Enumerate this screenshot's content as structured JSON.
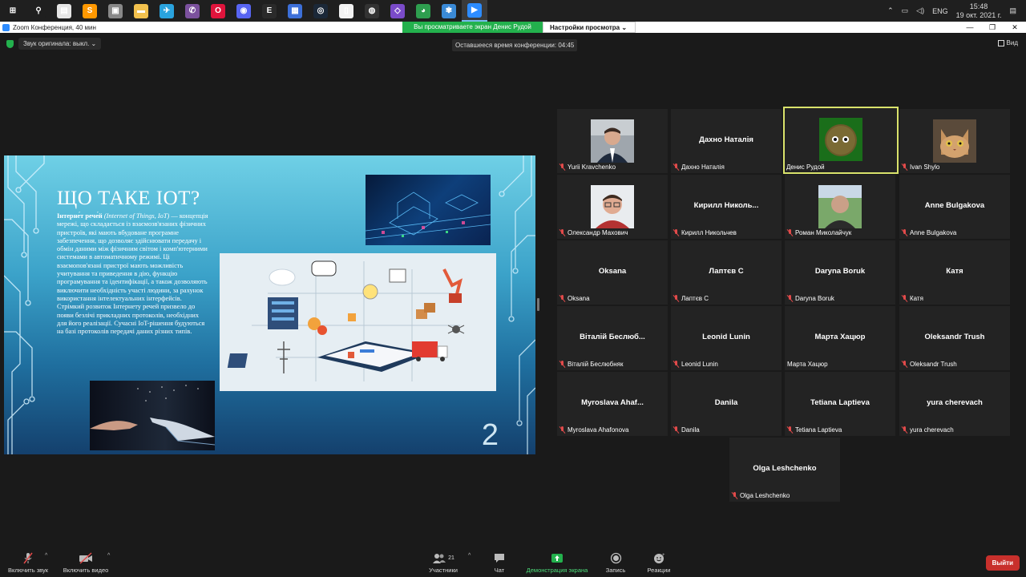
{
  "taskbar": {
    "apps": [
      {
        "name": "windows-start",
        "color": "#1f1f1f",
        "glyph": "⊞"
      },
      {
        "name": "search",
        "color": "#1f1f1f",
        "glyph": "⚲"
      },
      {
        "name": "store",
        "color": "#e6e6e6",
        "glyph": "▤"
      },
      {
        "name": "sublime",
        "color": "#ff9800",
        "glyph": "S"
      },
      {
        "name": "app-gray",
        "color": "#888888",
        "glyph": "▣"
      },
      {
        "name": "folder",
        "color": "#f2c14e",
        "glyph": "▬"
      },
      {
        "name": "telegram",
        "color": "#2aa3de",
        "glyph": "✈"
      },
      {
        "name": "viber",
        "color": "#7b519d",
        "glyph": "✆"
      },
      {
        "name": "opera",
        "color": "#e0143c",
        "glyph": "O"
      },
      {
        "name": "discord",
        "color": "#5865f2",
        "glyph": "◉"
      },
      {
        "name": "epic",
        "color": "#2a2a2a",
        "glyph": "E"
      },
      {
        "name": "app-blue",
        "color": "#3c6fd8",
        "glyph": "▦"
      },
      {
        "name": "steam",
        "color": "#1b2838",
        "glyph": "◎"
      },
      {
        "name": "document",
        "color": "#f2f2f2",
        "glyph": "▯"
      },
      {
        "name": "obs",
        "color": "#333333",
        "glyph": "◍"
      },
      {
        "name": "visual-studio",
        "color": "#7a4bc9",
        "glyph": "◇"
      },
      {
        "name": "chrome",
        "color": "#2e9e4f",
        "glyph": "◕"
      },
      {
        "name": "app-light-blue",
        "color": "#3a8ad6",
        "glyph": "✾"
      },
      {
        "name": "zoom",
        "color": "#2d8cff",
        "glyph": "▶"
      }
    ],
    "lang": "ENG",
    "time": "15:48",
    "date": "19 окт. 2021 г."
  },
  "titlebar": {
    "title": "Zoom Конференция, 40 мин",
    "share_banner": "Вы просматриваете экран Денис Рудой",
    "view_options": "Настройки просмотра"
  },
  "meeting": {
    "original_sound": "Звук оригинала: выкл.",
    "time_left": "Оставшееся время конференции: 04:45",
    "view_label": "Вид"
  },
  "slide": {
    "title": "ЩО ТАКЕ IOT?",
    "body_bold": "Інтерне́т рече́й",
    "body_italic": "(Internet of Things, IoT)",
    "body_rest": " — концепція мережі, що складається із взаємозв'язаних фізичних пристроїв, які мають вбудоване програмне забезпечення, що дозволяє здійснювати передачу і обмін даними між фізичним світом і комп'ютерними системами в автоматичному режимі. Ці взаємопов'язані пристрої мають можливість учитування та приведення в дію, функцію програмування та ідентифікації, а також дозволяють виключити необхідність участі людини, за рахунок використання інтелектуальних інтерфейсів. Стрімкий розвиток Інтернету речей призвело до появи безлічі прикладних протоколів, необхідних для його реалізації. Сучасні IoT-рішення будуються на базі протоколів передачі даних різних типів.",
    "page_number": "2"
  },
  "participants": [
    {
      "display": "",
      "label": "Yurii Kravchenko",
      "photo": "man-suit",
      "muted": true,
      "active": false
    },
    {
      "display": "Дахно Наталія",
      "label": "Дахно Наталія",
      "photo": "",
      "muted": true,
      "active": false
    },
    {
      "display": "",
      "label": "Денис Рудой",
      "photo": "green-creature",
      "muted": false,
      "active": true
    },
    {
      "display": "",
      "label": "Ivan Shylo",
      "photo": "cat",
      "muted": true,
      "active": false
    },
    {
      "display": "",
      "label": "Олександр Махович",
      "photo": "man-glasses",
      "muted": true,
      "active": false
    },
    {
      "display": "Кирилл  Николь...",
      "label": "Кирилл Никольчев",
      "photo": "",
      "muted": true,
      "active": false
    },
    {
      "display": "",
      "label": "Роман Миколайчук",
      "photo": "man-outdoor",
      "muted": true,
      "active": false
    },
    {
      "display": "Anne Bulgakova",
      "label": "Anne Bulgakova",
      "photo": "",
      "muted": true,
      "active": false
    },
    {
      "display": "Oksana",
      "label": "Oksana",
      "photo": "",
      "muted": true,
      "active": false
    },
    {
      "display": "Лаптєв С",
      "label": "Лаптєв С",
      "photo": "",
      "muted": true,
      "active": false
    },
    {
      "display": "Daryna Boruk",
      "label": "Daryna Boruk",
      "photo": "",
      "muted": true,
      "active": false
    },
    {
      "display": "Катя",
      "label": "Катя",
      "photo": "",
      "muted": true,
      "active": false
    },
    {
      "display": "Віталій  Беслюб...",
      "label": "Віталій Беслюбняк",
      "photo": "",
      "muted": true,
      "active": false
    },
    {
      "display": "Leonid Lunin",
      "label": "Leonid Lunin",
      "photo": "",
      "muted": true,
      "active": false
    },
    {
      "display": "Марта Хацюр",
      "label": "Марта Хацюр",
      "photo": "",
      "muted": false,
      "active": false
    },
    {
      "display": "Oleksandr  Trush",
      "label": "Oleksandr  Trush",
      "photo": "",
      "muted": true,
      "active": false
    },
    {
      "display": "Myroslava  Ahaf...",
      "label": "Myroslava Ahafonova",
      "photo": "",
      "muted": true,
      "active": false
    },
    {
      "display": "Danila",
      "label": "Danila",
      "photo": "",
      "muted": true,
      "active": false
    },
    {
      "display": "Tetiana Laptieva",
      "label": "Tetiana Laptieva",
      "photo": "",
      "muted": true,
      "active": false
    },
    {
      "display": "yura cherevach",
      "label": "yura cherevach",
      "photo": "",
      "muted": true,
      "active": false
    },
    {
      "display": "Olga Leshchenko",
      "label": "Olga Leshchenko",
      "photo": "",
      "muted": true,
      "active": false
    }
  ],
  "toolbar": {
    "unmute": "Включить звук",
    "start_video": "Включить видео",
    "participants": "Участники",
    "participants_count": "21",
    "chat": "Чат",
    "share_screen": "Демонстрация экрана",
    "record": "Запись",
    "reactions": "Реакции",
    "leave": "Выйти"
  },
  "colors": {
    "active_speaker": "#d9e26b",
    "share_green": "#23b14d",
    "leave_red": "#c8302c",
    "muted_red": "#e24a4a"
  }
}
